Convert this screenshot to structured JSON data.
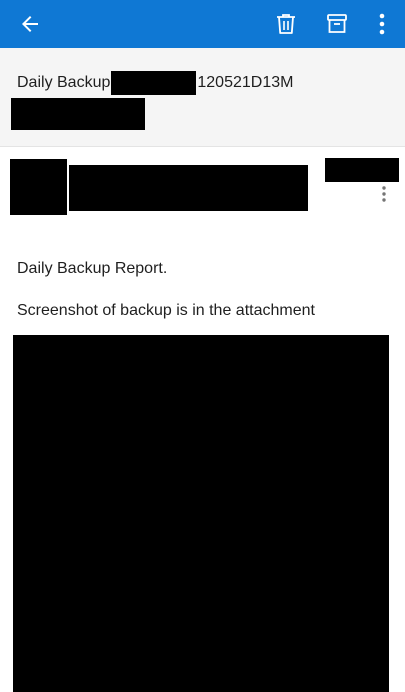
{
  "toolbar": {
    "background": "#0F78D4",
    "back_icon": "arrow-left-icon",
    "delete_icon": "trash-icon",
    "archive_icon": "archive-icon",
    "more_icon": "more-vertical-icon"
  },
  "email": {
    "subject_prefix": "Daily Backup",
    "subject_suffix": "120521D13M",
    "body": {
      "line1": "Daily Backup Report.",
      "line2": "Screenshot of backup is in the attachment"
    }
  },
  "sender": {
    "more_icon": "more-vertical-icon"
  }
}
